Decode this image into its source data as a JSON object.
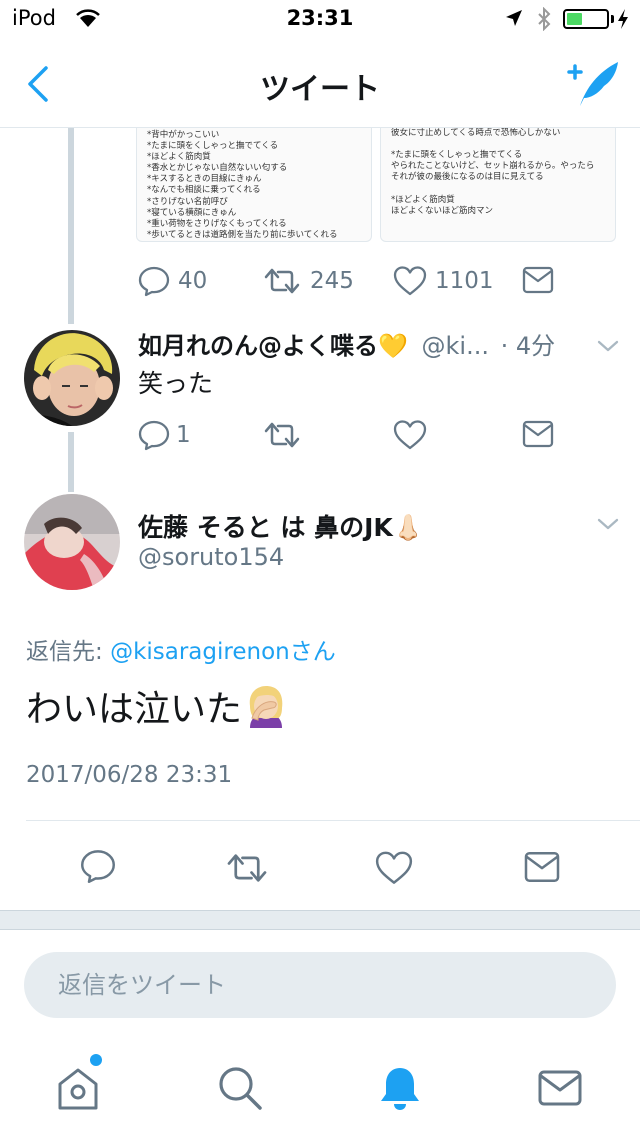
{
  "status_bar": {
    "carrier": "iPod",
    "time": "23:31",
    "battery_level": 0.4,
    "battery_color": "#4cd964"
  },
  "nav": {
    "title": "ツイート",
    "back_icon": "chevron-left-icon",
    "compose_icon": "compose-tweet-icon",
    "accent_color": "#1da1f2"
  },
  "quoted_tweet": {
    "media_left_lines": [
      "*背中がかっこいい",
      "*たまに頭をくしゃっと撫でてくる",
      "*ほどよく筋肉質",
      "*香水とかじゃない自然ないい匂する",
      "*キスするときの目線にきゅん",
      "*なんでも相談に乗ってくれる",
      "*さりげない名前呼び",
      "*寝ている横顔にきゅん",
      "*重い荷物をさりげなくもってくれる",
      "*歩いてるときは道路側を当たり前に歩いてくれる"
    ],
    "media_right_lines": [
      "彼女に寸止めしてくる時点で恐怖心しかない",
      "",
      "*たまに頭をくしゃっと撫でてくる",
      "やられたことないけど、セット崩れるから。やったら",
      "それが彼の最後になるのは目に見えてる",
      "",
      "*ほどよく筋肉質",
      "ほどよくないほど筋肉マン"
    ],
    "reply_count": "40",
    "retweet_count": "245",
    "like_count": "1101"
  },
  "reply_tweet": {
    "name": "如月れのん@よく喋る💛",
    "handle": "@ki...",
    "time_ago": "· 4分",
    "text": "笑った",
    "reply_count": "1"
  },
  "main_tweet": {
    "name": "佐藤 そると は 鼻のJK👃🏻",
    "handle": "@soruto154",
    "reply_to_label": "返信先: ",
    "reply_to_user": "@kisaragirenonさん",
    "text": "わいは泣いた",
    "emoji": "facepalm",
    "timestamp": "2017/06/28 23:31"
  },
  "composer": {
    "placeholder": "返信をツイート"
  },
  "tabs": [
    {
      "icon": "home-icon",
      "has_badge": true
    },
    {
      "icon": "search-icon"
    },
    {
      "icon": "notifications-bell-icon",
      "active": true
    },
    {
      "icon": "messages-envelope-icon"
    }
  ],
  "colors": {
    "gray_text": "#657786",
    "icon_gray": "#657786",
    "link": "#1da1f2"
  }
}
